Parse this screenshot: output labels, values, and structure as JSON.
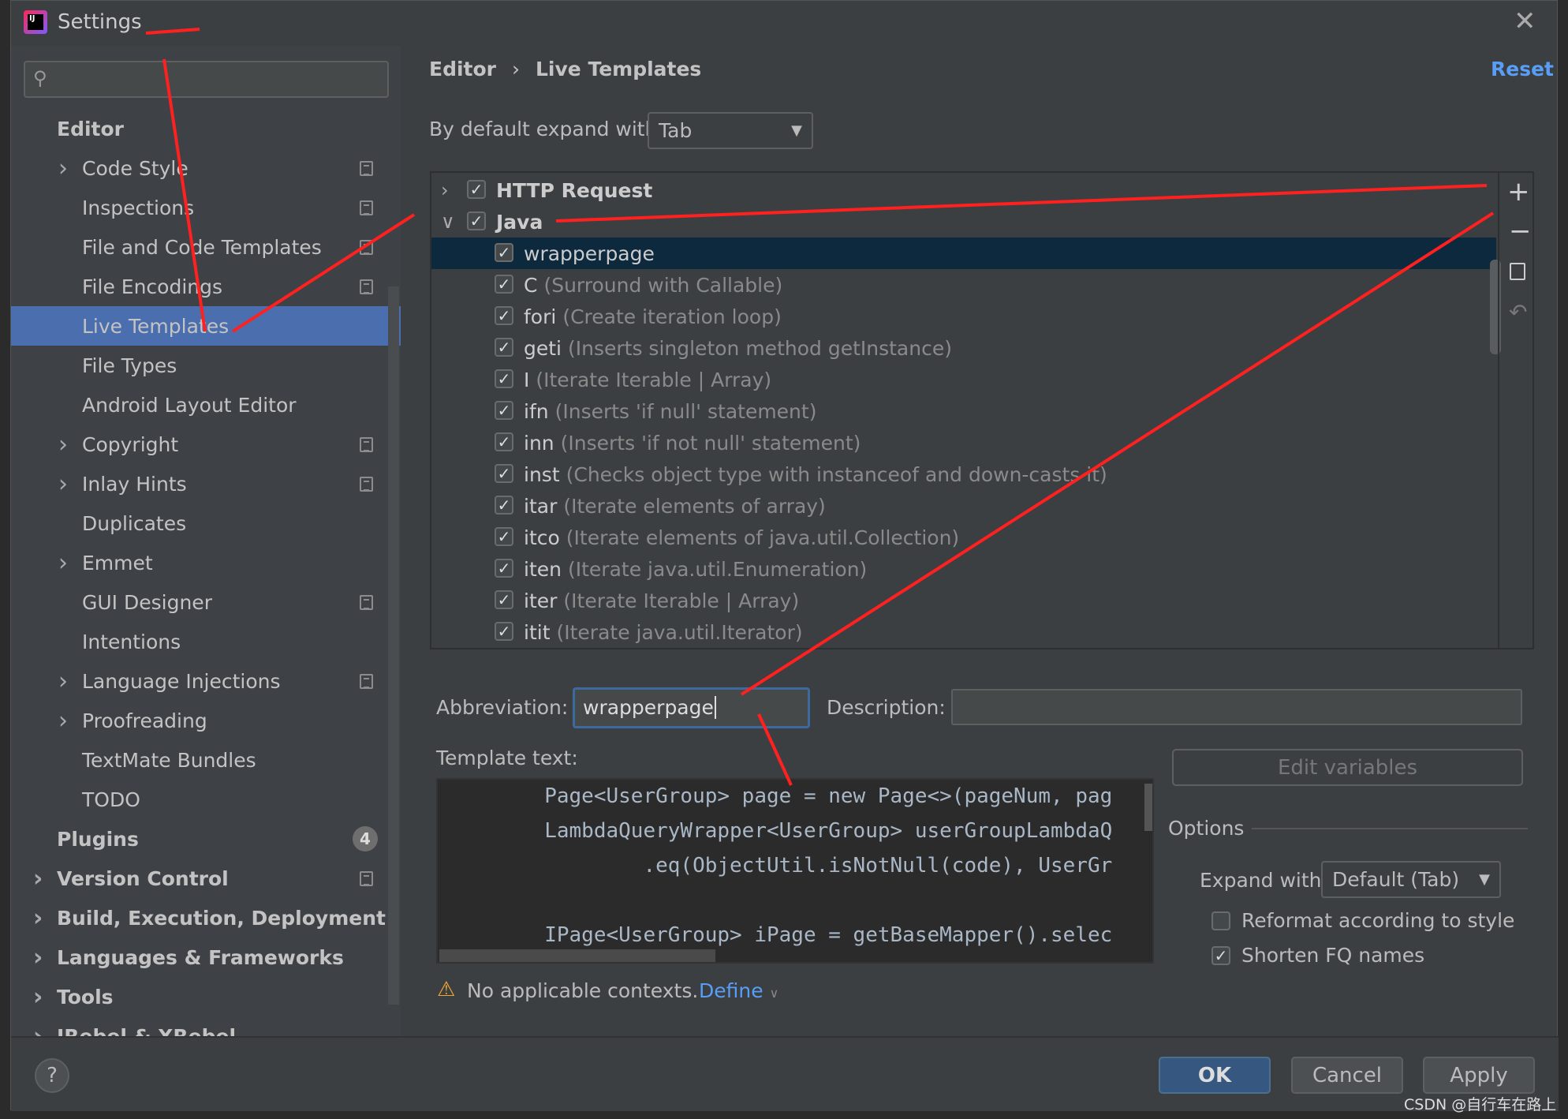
{
  "window": {
    "title": "Settings",
    "close_icon": "close-icon"
  },
  "search": {
    "placeholder": ""
  },
  "sidebar": {
    "items": [
      {
        "label": "Editor",
        "level": 0,
        "bold": true
      },
      {
        "label": "Code Style",
        "level": 1,
        "expandable": true,
        "copy": true
      },
      {
        "label": "Inspections",
        "level": 1,
        "copy": true
      },
      {
        "label": "File and Code Templates",
        "level": 1,
        "copy": true
      },
      {
        "label": "File Encodings",
        "level": 1,
        "copy": true
      },
      {
        "label": "Live Templates",
        "level": 1,
        "selected": true
      },
      {
        "label": "File Types",
        "level": 1
      },
      {
        "label": "Android Layout Editor",
        "level": 1
      },
      {
        "label": "Copyright",
        "level": 1,
        "expandable": true,
        "copy": true
      },
      {
        "label": "Inlay Hints",
        "level": 1,
        "expandable": true,
        "copy": true
      },
      {
        "label": "Duplicates",
        "level": 1
      },
      {
        "label": "Emmet",
        "level": 1,
        "expandable": true
      },
      {
        "label": "GUI Designer",
        "level": 1,
        "copy": true
      },
      {
        "label": "Intentions",
        "level": 1
      },
      {
        "label": "Language Injections",
        "level": 1,
        "expandable": true,
        "copy": true
      },
      {
        "label": "Proofreading",
        "level": 1,
        "expandable": true
      },
      {
        "label": "TextMate Bundles",
        "level": 1
      },
      {
        "label": "TODO",
        "level": 1
      },
      {
        "label": "Plugins",
        "level": 0,
        "bold": true,
        "badge": "4"
      },
      {
        "label": "Version Control",
        "level": 0,
        "bold": true,
        "expandable": true,
        "copy": true
      },
      {
        "label": "Build, Execution, Deployment",
        "level": 0,
        "bold": true,
        "expandable": true
      },
      {
        "label": "Languages & Frameworks",
        "level": 0,
        "bold": true,
        "expandable": true
      },
      {
        "label": "Tools",
        "level": 0,
        "bold": true,
        "expandable": true
      },
      {
        "label": "JRebel & XRebel",
        "level": 0,
        "bold": true,
        "expandable": true
      }
    ]
  },
  "main": {
    "breadcrumb": [
      "Editor",
      "Live Templates"
    ],
    "reset": "Reset",
    "expand_label": "By default expand with",
    "expand_value": "Tab",
    "templates": [
      {
        "abbr": "HTTP Request",
        "group": true,
        "expanded": false,
        "checked": true
      },
      {
        "abbr": "Java",
        "group": true,
        "expanded": true,
        "checked": true
      },
      {
        "abbr": "wrapperpage",
        "desc": "",
        "checked": true,
        "selected": true
      },
      {
        "abbr": "C",
        "desc": "(Surround with Callable)",
        "checked": true
      },
      {
        "abbr": "fori",
        "desc": "(Create iteration loop)",
        "checked": true
      },
      {
        "abbr": "geti",
        "desc": "(Inserts singleton method getInstance)",
        "checked": true
      },
      {
        "abbr": "I",
        "desc": "(Iterate Iterable | Array)",
        "checked": true
      },
      {
        "abbr": "ifn",
        "desc": "(Inserts 'if null' statement)",
        "checked": true
      },
      {
        "abbr": "inn",
        "desc": "(Inserts 'if not null' statement)",
        "checked": true
      },
      {
        "abbr": "inst",
        "desc": "(Checks object type with instanceof and down-casts it)",
        "checked": true
      },
      {
        "abbr": "itar",
        "desc": "(Iterate elements of array)",
        "checked": true
      },
      {
        "abbr": "itco",
        "desc": "(Iterate elements of java.util.Collection)",
        "checked": true
      },
      {
        "abbr": "iten",
        "desc": "(Iterate java.util.Enumeration)",
        "checked": true
      },
      {
        "abbr": "iter",
        "desc": "(Iterate Iterable | Array)",
        "checked": true
      },
      {
        "abbr": "itit",
        "desc": "(Iterate java.util.Iterator)",
        "checked": true
      }
    ],
    "abbreviation_label": "Abbreviation:",
    "abbreviation_value": "wrapperpage",
    "description_label": "Description:",
    "description_value": "",
    "template_text_label": "Template text:",
    "template_lines": [
      "        Page<UserGroup> page = new Page<>(pageNum, pag",
      "        LambdaQueryWrapper<UserGroup> userGroupLambdaQ",
      "                .eq(ObjectUtil.isNotNull(code), UserGr",
      "",
      "        IPage<UserGroup> iPage = getBaseMapper().selec"
    ],
    "edit_variables": "Edit variables",
    "options_label": "Options",
    "options_expand_label": "Expand with",
    "options_expand_value": "Default (Tab)",
    "reformat_label": "Reformat according to style",
    "reformat_checked": false,
    "shorten_label": "Shorten FQ names",
    "shorten_checked": true,
    "warning_text": "No applicable contexts.",
    "define_link": "Define"
  },
  "footer": {
    "help": "?",
    "ok": "OK",
    "cancel": "Cancel",
    "apply": "Apply"
  },
  "watermark": "CSDN @自行车在路上",
  "colors": {
    "selection": "#4b6eaf",
    "list_selection": "#0d293e",
    "link": "#589df6",
    "annotation": "#ff2020"
  }
}
